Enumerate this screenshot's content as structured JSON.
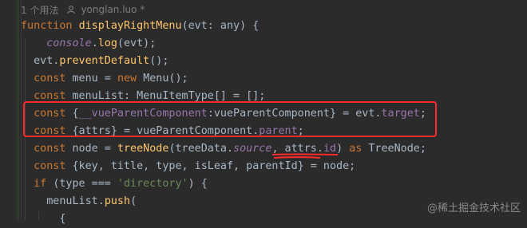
{
  "usage_hint": {
    "usages": "1 个用法",
    "author": "yonglan.luo *"
  },
  "code": {
    "l1": {
      "kw": "function ",
      "name": "displayRightMenu",
      "rest": "(evt: any) {"
    },
    "l2": {
      "obj": "console",
      "dot": ".",
      "method": "log",
      "rest": "(evt);"
    },
    "l3": {
      "pre": "evt.",
      "method": "preventDefault",
      "rest": "();"
    },
    "l4": {
      "kw": "const ",
      "name": "menu = ",
      "kw2": "new ",
      "rest": "Menu();"
    },
    "l5": {
      "kw": "const ",
      "rest": "menuList: MenuItemType[] = [];"
    },
    "l6": {
      "kw": "const ",
      "pre": "{",
      "prop": "__vueParentComponent",
      "mid": ":vueParentComponent} = evt.",
      "prop2": "target",
      "end": ";"
    },
    "l7": {
      "kw": "const ",
      "pre": "{attrs} = vueParentComponent.",
      "prop": "parent",
      "end": ";"
    },
    "l8": {
      "kw": "const ",
      "pre": "node = ",
      "fn": "treeNode",
      "mid": "(treeData.",
      "prop": "source",
      "mid2": ", attrs.",
      "prop2": "id",
      "mid3": ") ",
      "kw2": "as ",
      "end": "TreeNode;"
    },
    "l9": {
      "kw": "const ",
      "rest": "{key, title, type, isLeaf, parentId} = node;"
    },
    "l10": {
      "kw": "if ",
      "pre": "(type === ",
      "str": "'directory'",
      "end": ") {"
    },
    "l11": {
      "pre": "menuList.",
      "method": "push",
      "end": "("
    },
    "l12": {
      "text": "{"
    }
  },
  "watermark": "@稀土掘金技术社区"
}
